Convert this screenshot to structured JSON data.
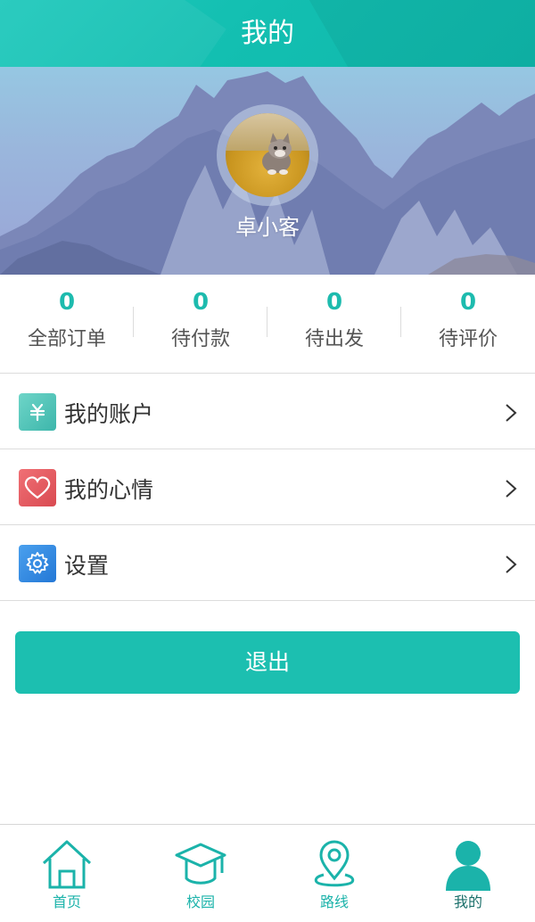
{
  "header": {
    "title": "我的"
  },
  "profile": {
    "username": "卓小客"
  },
  "stats": [
    {
      "count": "0",
      "label": "全部订单"
    },
    {
      "count": "0",
      "label": "待付款"
    },
    {
      "count": "0",
      "label": "待出发"
    },
    {
      "count": "0",
      "label": "待评价"
    }
  ],
  "menu": [
    {
      "label": "我的账户",
      "icon": "yuan-wallet-icon",
      "color": "#4fc3b8"
    },
    {
      "label": "我的心情",
      "icon": "heart-icon",
      "color": "#e25b60"
    },
    {
      "label": "设置",
      "icon": "gear-icon",
      "color": "#2f86e0"
    }
  ],
  "logout": {
    "label": "退出"
  },
  "tabbar": [
    {
      "label": "首页",
      "icon": "home-icon"
    },
    {
      "label": "校园",
      "icon": "graduation-cap-icon"
    },
    {
      "label": "路线",
      "icon": "location-pin-icon"
    },
    {
      "label": "我的",
      "icon": "user-icon",
      "active": true
    }
  ],
  "colors": {
    "accent": "#1cbfb0",
    "tab": "#1bb3aa"
  }
}
